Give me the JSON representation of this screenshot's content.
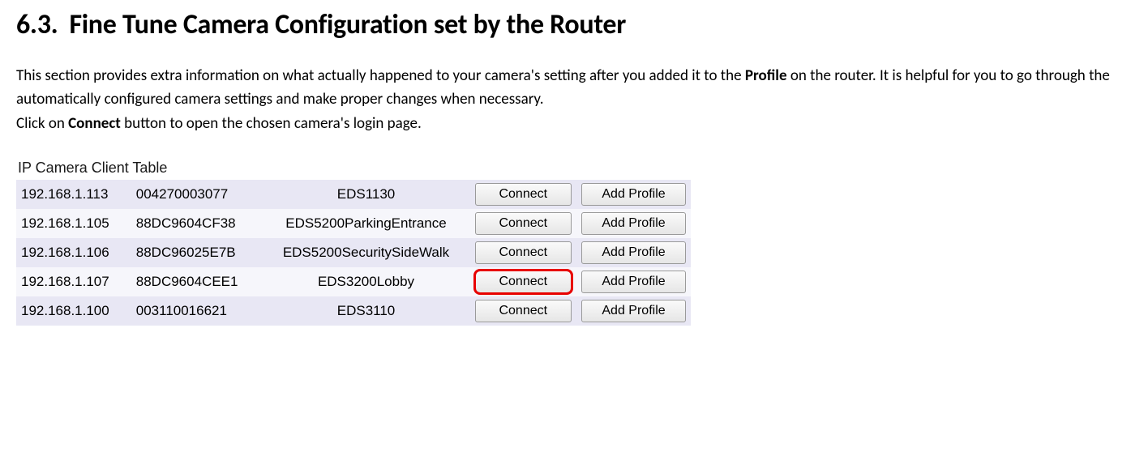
{
  "heading": {
    "number": "6.3.",
    "title": "Fine Tune Camera Configuration set by the Router"
  },
  "paragraphs": {
    "p1_pre": "This section provides extra information on what actually happened to your camera's setting after you added it to the ",
    "p1_bold": "Profile",
    "p1_post": " on the router. It is helpful for you to go through the automatically configured camera settings and make proper changes when necessary.",
    "p2_pre": "Click on ",
    "p2_bold": "Connect",
    "p2_post": " button to open the chosen camera's login page."
  },
  "table_title": "IP Camera Client Table",
  "buttons": {
    "connect": "Connect",
    "add_profile": "Add Profile"
  },
  "rows": [
    {
      "ip": "192.168.1.113",
      "mac": "004270003077",
      "name": "EDS1130",
      "highlight": false
    },
    {
      "ip": "192.168.1.105",
      "mac": "88DC9604CF38",
      "name": "EDS5200ParkingEntrance",
      "highlight": false
    },
    {
      "ip": "192.168.1.106",
      "mac": "88DC96025E7B",
      "name": "EDS5200SecuritySideWalk",
      "highlight": false
    },
    {
      "ip": "192.168.1.107",
      "mac": "88DC9604CEE1",
      "name": "EDS3200Lobby",
      "highlight": true
    },
    {
      "ip": "192.168.1.100",
      "mac": "003110016621",
      "name": "EDS3110",
      "highlight": false
    }
  ]
}
